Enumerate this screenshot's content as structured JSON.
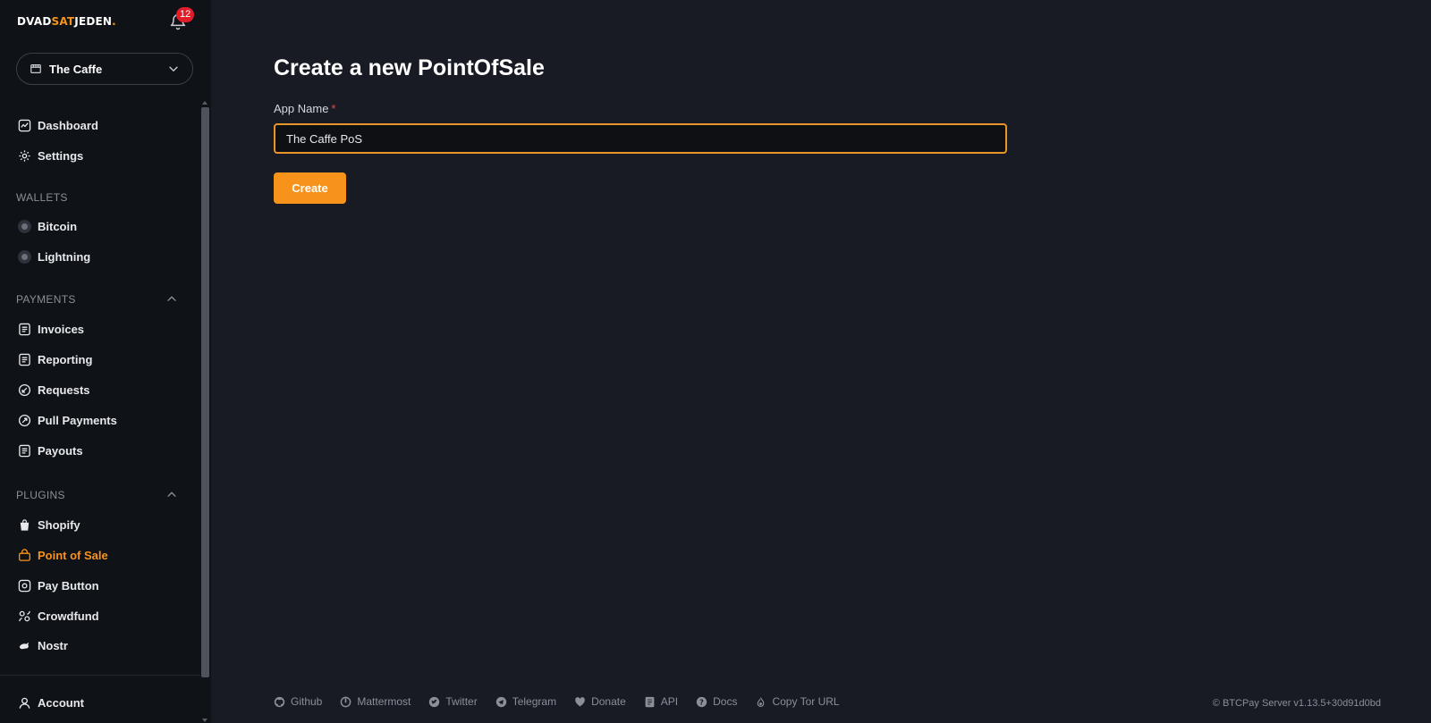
{
  "brand": {
    "part1": "DVAD",
    "part2": "SAT",
    "part3": "JEDEN",
    "dot": "."
  },
  "notifications": {
    "count": "12"
  },
  "store": {
    "name": "The Caffe"
  },
  "sidebar": {
    "top_items": [
      {
        "label": "Dashboard",
        "icon": "dashboard-icon"
      },
      {
        "label": "Settings",
        "icon": "gear-icon"
      }
    ],
    "wallets_heading": "WALLETS",
    "wallets": [
      {
        "label": "Bitcoin"
      },
      {
        "label": "Lightning"
      }
    ],
    "payments_heading": "PAYMENTS",
    "payments": [
      {
        "label": "Invoices"
      },
      {
        "label": "Reporting"
      },
      {
        "label": "Requests"
      },
      {
        "label": "Pull Payments"
      },
      {
        "label": "Payouts"
      }
    ],
    "plugins_heading": "PLUGINS",
    "plugins": [
      {
        "label": "Shopify"
      },
      {
        "label": "Point of Sale"
      },
      {
        "label": "Pay Button"
      },
      {
        "label": "Crowdfund"
      },
      {
        "label": "Nostr"
      }
    ],
    "account": "Account"
  },
  "main": {
    "title": "Create a new PointOfSale",
    "app_name_label": "App Name",
    "required_marker": "*",
    "app_name_value": "The Caffe PoS",
    "create_label": "Create"
  },
  "footer": {
    "links": [
      "Github",
      "Mattermost",
      "Twitter",
      "Telegram",
      "Donate",
      "API",
      "Docs",
      "Copy Tor URL"
    ],
    "version": "© BTCPay Server v1.13.5+30d91d0bd"
  },
  "colors": {
    "accent": "#f7931a",
    "background": "#181b23",
    "sidebar": "#0f1217"
  }
}
